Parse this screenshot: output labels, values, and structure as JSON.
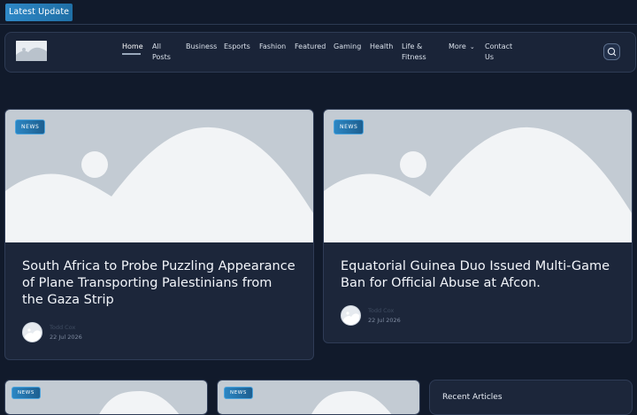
{
  "ticker": {
    "label": "Latest Update"
  },
  "header": {
    "nav": [
      {
        "label": "Home",
        "active": true
      },
      {
        "label": "All Posts"
      },
      {
        "label": "Business"
      },
      {
        "label": "Esports"
      },
      {
        "label": "Fashion"
      },
      {
        "label": "Featured"
      },
      {
        "label": "Gaming"
      },
      {
        "label": "Health"
      },
      {
        "label": "Life & Fitness"
      },
      {
        "label": "More"
      },
      {
        "label": "Contact Us"
      }
    ],
    "icons": {
      "more": "chevron-down-icon",
      "search": "search-icon"
    }
  },
  "posts": [
    {
      "category": "NEWS",
      "title": "South Africa to Probe Puzzling Appearance of Plane Transporting Palestinians from the Gaza Strip",
      "author": "Todd Cox",
      "date": "22 Jul 2026"
    },
    {
      "category": "NEWS",
      "title": "Equatorial Guinea Duo Issued Multi-Game Ban for Official Abuse at Afcon.",
      "author": "Todd Cox",
      "date": "22 Jul 2026"
    },
    {
      "category": "NEWS"
    },
    {
      "category": "NEWS"
    }
  ],
  "sidebar": {
    "title": "Recent Articles"
  },
  "colors": {
    "background": "#111a2b",
    "card": "#1c263a",
    "accent": "#2b86c3",
    "placeholder_bg": "#c3cbd3",
    "placeholder_fg": "#f2f4f6"
  }
}
